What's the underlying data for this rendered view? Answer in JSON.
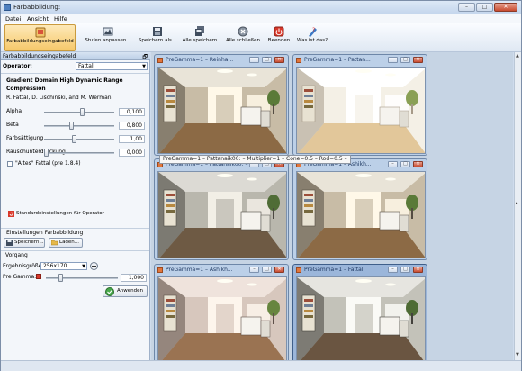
{
  "window": {
    "title": "Farbabbildung:",
    "buttons": {
      "min": "–",
      "max": "□",
      "close": "✕"
    }
  },
  "menu": [
    "Datei",
    "Ansicht",
    "Hilfe"
  ],
  "toolbar": [
    {
      "label": "Farbabbildungseingabefeld",
      "icon": "panel-icon",
      "active": true
    },
    {
      "label": "Stufen anpassen...",
      "icon": "levels-icon"
    },
    {
      "label": "Speichern als...",
      "icon": "save-icon"
    },
    {
      "label": "Alle speichern",
      "icon": "save-all-icon"
    },
    {
      "label": "Alle schließen",
      "icon": "close-all-icon"
    },
    {
      "label": "Beenden",
      "icon": "power-icon"
    },
    {
      "label": "Was ist das?",
      "icon": "help-icon"
    }
  ],
  "panel": {
    "title": "Farbabbildungseingabefeld",
    "pin": "🗗",
    "operator_label": "Operator:",
    "operator_value": "Fattal",
    "algo_title_1": "Gradient Domain High Dynamic Range",
    "algo_title_2": "Compression",
    "authors": "R. Fattal, D. Lischinski, and M. Werman",
    "params": [
      {
        "label": "Alpha",
        "value": "0,100",
        "level": 0.55
      },
      {
        "label": "Beta",
        "value": "0,800",
        "level": 0.38
      },
      {
        "label": "Farbsättigung",
        "value": "1,00",
        "level": 0.42
      },
      {
        "label": "Rauschunterdrückung",
        "value": "0,000",
        "level": 0.0
      }
    ],
    "old_fattal": "\"Altes\" Fattal (pre 1.8.4)",
    "defaults_button": "Standardeinstellungen für Operator",
    "settings_label": "Einstellungen Farbabbildung",
    "save_button": "Speichern...",
    "load_button": "Laden...",
    "process_label": "Vorgang",
    "result_size_label": "Ergebnisgröße:",
    "result_size_value": "256x170",
    "pregamma_label": "Pre Gamma:",
    "pregamma_value": "1,000",
    "pregamma_level": 0.18,
    "apply_button": "Anwenden"
  },
  "tooltip": "PreGamma=1 – Pattanaik00: – Multiplier=1 – Cone=0.5 – Rod=0.5 –",
  "images": [
    {
      "title": "PreGamma=1 – Reinha...",
      "variant": "warm",
      "active": false
    },
    {
      "title": "PreGamma=1 – Pattan...",
      "variant": "bright",
      "active": false
    },
    {
      "title": "PreGamma=1 – Pattanaik00: – Multiplier=1 – Cone=0.5 – Rod=0.5 –",
      "variant": "neutral",
      "active": false
    },
    {
      "title": "PreGamma=1 – Ashikh...",
      "variant": "warm",
      "active": false
    },
    {
      "title": "PreGamma=1 – Ashikh...",
      "variant": "pinkish",
      "active": false
    },
    {
      "title": "PreGamma=1 – Fattal:",
      "variant": "fattal",
      "active": true
    }
  ],
  "image_buttons": {
    "min": "–",
    "max": "□",
    "close": "✕"
  }
}
